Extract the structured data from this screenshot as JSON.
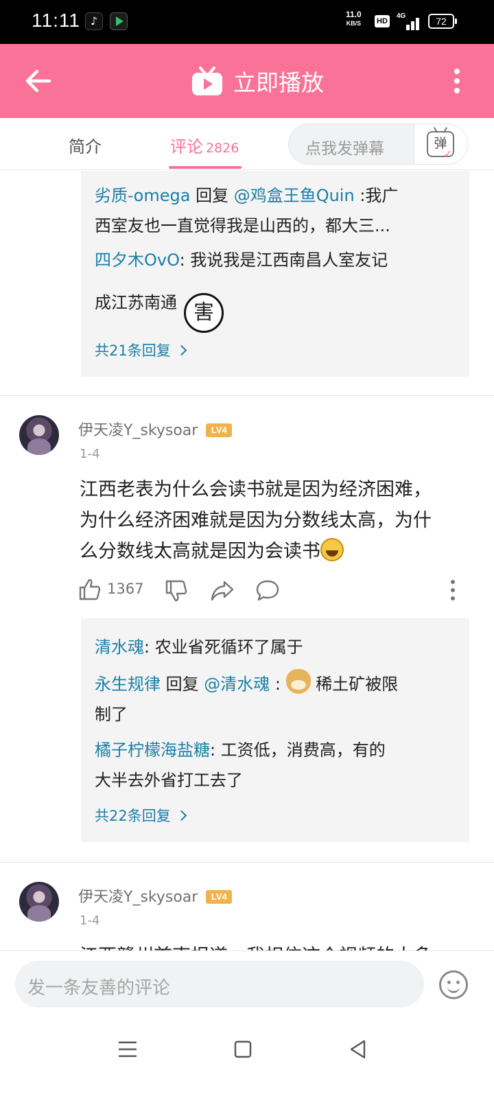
{
  "status_bar": {
    "time": "11:11",
    "net_speed_value": "11.0",
    "net_speed_unit": "KB/S",
    "hd_label": "HD",
    "network_label": "4G",
    "battery": "72"
  },
  "header": {
    "play_label": "立即播放"
  },
  "tabs": {
    "intro": "简介",
    "comments": "评论",
    "comments_count": "2826",
    "danmaku_placeholder": "点我发弹幕",
    "danmaku_btn": "弹"
  },
  "thread1": {
    "replies": [
      {
        "name": "劣质-omega",
        "reply_word": " 回复 ",
        "target": "@鸡盒王鱼Quin",
        "text_l1": " :我广",
        "text_l2": "西室友也一直觉得我是山西的，都大三..."
      },
      {
        "name": "四夕木OvO",
        "text_l1": ": 我说我是江西南昌人室友记",
        "text_l2": "成江苏南通",
        "sticker": "害"
      }
    ],
    "more": "共21条回复"
  },
  "comment1": {
    "user": "伊天凌Y_skysoar",
    "level": "LV4",
    "time": "1-4",
    "lines": [
      "江西老表为什么会读书就是因为经济困难，",
      "为什么经济困难就是因为分数线太高，为什",
      "么分数线太高就是因为会读书"
    ],
    "likes": "1367",
    "replies": [
      {
        "name": "清水魂",
        "text": ": 农业省死循环了属于"
      },
      {
        "name": "永生规律",
        "reply_word": " 回复 ",
        "target": "@清水魂",
        "text_l1": " : ",
        "text_after_emoji": " 稀土矿被限",
        "text_l2": "制了"
      },
      {
        "name": "橘子柠檬海盐糖",
        "text_l1": ": 工资低，消费高，有的",
        "text_l2": "大半去外省打工去了"
      }
    ],
    "more": "共22条回复"
  },
  "comment2": {
    "user": "伊天凌Y_skysoar",
    "level": "LV4",
    "time": "1-4",
    "partial_text": "江西赣州首南报道，我相信这个视频的大多"
  },
  "bottom": {
    "comment_placeholder": "发一条友善的评论"
  },
  "colors": {
    "brand_pink": "#fb7299",
    "link_blue": "#1a7fa6"
  }
}
